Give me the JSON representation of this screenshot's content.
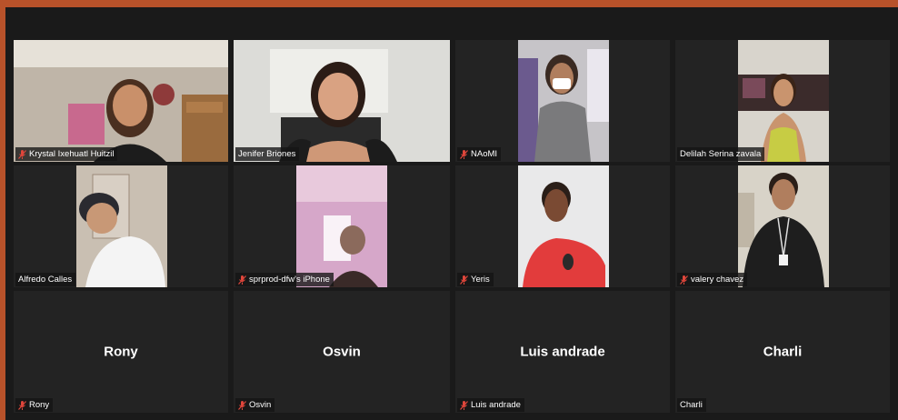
{
  "participants": [
    {
      "name": "Krystal Ixehuatl Huitzil",
      "muted": true,
      "video": true
    },
    {
      "name": "Jenifer Briones",
      "muted": false,
      "video": true,
      "active_speaker": true
    },
    {
      "name": "NAoMI",
      "muted": true,
      "video": true
    },
    {
      "name": "Delilah Serina zavala",
      "muted": false,
      "video": true
    },
    {
      "name": "Alfredo Calles",
      "muted": false,
      "video": true
    },
    {
      "name": "sprprod-dfw's iPhone",
      "muted": true,
      "video": true
    },
    {
      "name": "Yeris",
      "muted": true,
      "video": true
    },
    {
      "name": "valery chavez",
      "muted": true,
      "video": true
    },
    {
      "name": "Rony",
      "muted": true,
      "video": false,
      "center_label": "Rony"
    },
    {
      "name": "Osvin",
      "muted": true,
      "video": false,
      "center_label": "Osvin"
    },
    {
      "name": "Luis andrade",
      "muted": true,
      "video": false,
      "center_label": "Luis andrade"
    },
    {
      "name": "Charli",
      "muted": false,
      "video": false,
      "center_label": "Charli"
    }
  ],
  "colors": {
    "window_border": "#b8522a",
    "background": "#1a1a1a",
    "tile": "#232323",
    "active_speaker_outline": "#c7d96a",
    "mic_muted": "#e0463b"
  },
  "icons": {
    "muted": "mic-muted-icon"
  }
}
